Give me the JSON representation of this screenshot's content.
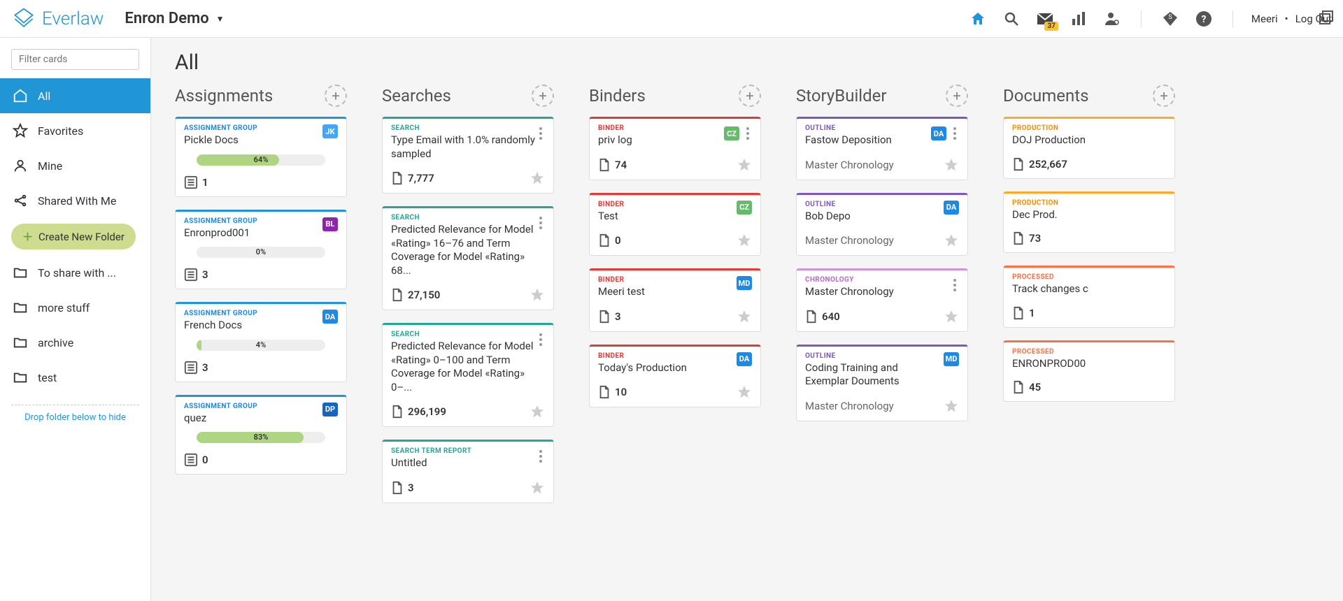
{
  "header": {
    "brand": "Everlaw",
    "project": "Enron Demo",
    "mail_badge": "37",
    "user": "Meeri",
    "logout": "Log Out"
  },
  "sidebar": {
    "filter_placeholder": "Filter cards",
    "items": [
      {
        "label": "All",
        "active": true
      },
      {
        "label": "Favorites",
        "active": false
      },
      {
        "label": "Mine",
        "active": false
      },
      {
        "label": "Shared With Me",
        "active": false
      }
    ],
    "create_folder": "Create New Folder",
    "folders": [
      {
        "label": "To share with ..."
      },
      {
        "label": "more stuff"
      },
      {
        "label": "archive"
      },
      {
        "label": "test"
      }
    ],
    "drop_hint": "Drop folder below to hide"
  },
  "page": {
    "title": "All"
  },
  "columns": [
    {
      "title": "Assignments",
      "cards": [
        {
          "kind": "assign",
          "type": "ASSIGNMENT GROUP",
          "title": "Pickle Docs",
          "avatar": "JK",
          "av_class": "jk",
          "progress": 64,
          "progress_label": "64%",
          "count": "1",
          "icon": "list",
          "show_menu": false
        },
        {
          "kind": "assign",
          "type": "ASSIGNMENT GROUP",
          "title": "Enronprod001",
          "avatar": "BL",
          "av_class": "bl",
          "progress": 0,
          "progress_label": "0%",
          "count": "3",
          "icon": "list",
          "show_menu": false
        },
        {
          "kind": "assign",
          "type": "ASSIGNMENT GROUP",
          "title": "French Docs",
          "avatar": "DA",
          "av_class": "da",
          "progress": 4,
          "progress_label": "4%",
          "count": "3",
          "icon": "list",
          "show_menu": false
        },
        {
          "kind": "assign",
          "type": "ASSIGNMENT GROUP",
          "title": "quez",
          "avatar": "DP",
          "av_class": "dp",
          "progress": 83,
          "progress_label": "83%",
          "count": "0",
          "icon": "list",
          "show_menu": false
        }
      ]
    },
    {
      "title": "Searches",
      "cards": [
        {
          "kind": "search",
          "type": "SEARCH",
          "title": "Type Email with 1.0% randomly sampled",
          "count": "7,777",
          "icon": "doc",
          "show_menu": true,
          "show_star": true
        },
        {
          "kind": "search",
          "type": "SEARCH",
          "title": "Predicted Relevance for Model «Rating» 16–76 and Term Coverage for Model «Rating» 68...",
          "count": "27,150",
          "icon": "doc",
          "show_menu": true,
          "show_star": true
        },
        {
          "kind": "search",
          "type": "SEARCH",
          "title": "Predicted Relevance for Model «Rating» 0–100 and Term Coverage for Model «Rating» 0–...",
          "count": "296,199",
          "icon": "doc",
          "show_menu": true,
          "show_star": true
        },
        {
          "kind": "search",
          "type": "SEARCH TERM REPORT",
          "title": "Untitled",
          "count": "3",
          "icon": "doc",
          "show_menu": true,
          "show_star": true
        }
      ]
    },
    {
      "title": "Binders",
      "cards": [
        {
          "kind": "binder",
          "type": "BINDER",
          "title": "priv log",
          "avatar": "CZ",
          "av_class": "cz",
          "count": "74",
          "icon": "doc",
          "show_menu": true,
          "show_star": true
        },
        {
          "kind": "binder",
          "type": "BINDER",
          "title": "Test",
          "avatar": "CZ",
          "av_class": "cz",
          "count": "0",
          "icon": "doc",
          "show_menu": false,
          "show_star": true
        },
        {
          "kind": "binder",
          "type": "BINDER",
          "title": "Meeri test",
          "avatar": "MD",
          "av_class": "md",
          "count": "3",
          "icon": "doc",
          "show_menu": false,
          "show_star": true
        },
        {
          "kind": "binder",
          "type": "BINDER",
          "title": "Today's Production",
          "avatar": "DA",
          "av_class": "da",
          "count": "10",
          "icon": "doc",
          "show_menu": false,
          "show_star": true
        }
      ]
    },
    {
      "title": "StoryBuilder",
      "cards": [
        {
          "kind": "outline",
          "type": "OUTLINE",
          "title": "Fastow Deposition",
          "avatar": "DA",
          "av_class": "da",
          "sub": "Master Chronology",
          "icon": "none",
          "show_menu": true,
          "show_star": true
        },
        {
          "kind": "outline",
          "type": "OUTLINE",
          "title": "Bob Depo",
          "avatar": "DA",
          "av_class": "da",
          "sub": "Master Chronology",
          "icon": "none",
          "show_menu": false,
          "show_star": true
        },
        {
          "kind": "chronology",
          "type": "CHRONOLOGY",
          "title": "Master Chronology",
          "count": "640",
          "icon": "doc",
          "show_menu": true,
          "show_star": true
        },
        {
          "kind": "outline",
          "type": "OUTLINE",
          "title": "Coding Training and Exemplar Douments",
          "avatar": "MD",
          "av_class": "md",
          "sub": "Master Chronology",
          "icon": "none",
          "show_menu": false,
          "show_star": true
        }
      ]
    },
    {
      "title": "Documents",
      "cards": [
        {
          "kind": "production",
          "type": "PRODUCTION",
          "title": "DOJ Production",
          "count": "252,667",
          "icon": "doc",
          "show_menu": false
        },
        {
          "kind": "production",
          "type": "PRODUCTION",
          "title": "Dec Prod.",
          "count": "73",
          "icon": "doc",
          "show_menu": false
        },
        {
          "kind": "processed",
          "type": "PROCESSED",
          "title": "Track changes c",
          "count": "1",
          "icon": "doc",
          "show_menu": false
        },
        {
          "kind": "processed",
          "type": "PROCESSED",
          "title": "ENRONPROD00",
          "count": "45",
          "icon": "doc",
          "show_menu": false
        }
      ]
    }
  ]
}
